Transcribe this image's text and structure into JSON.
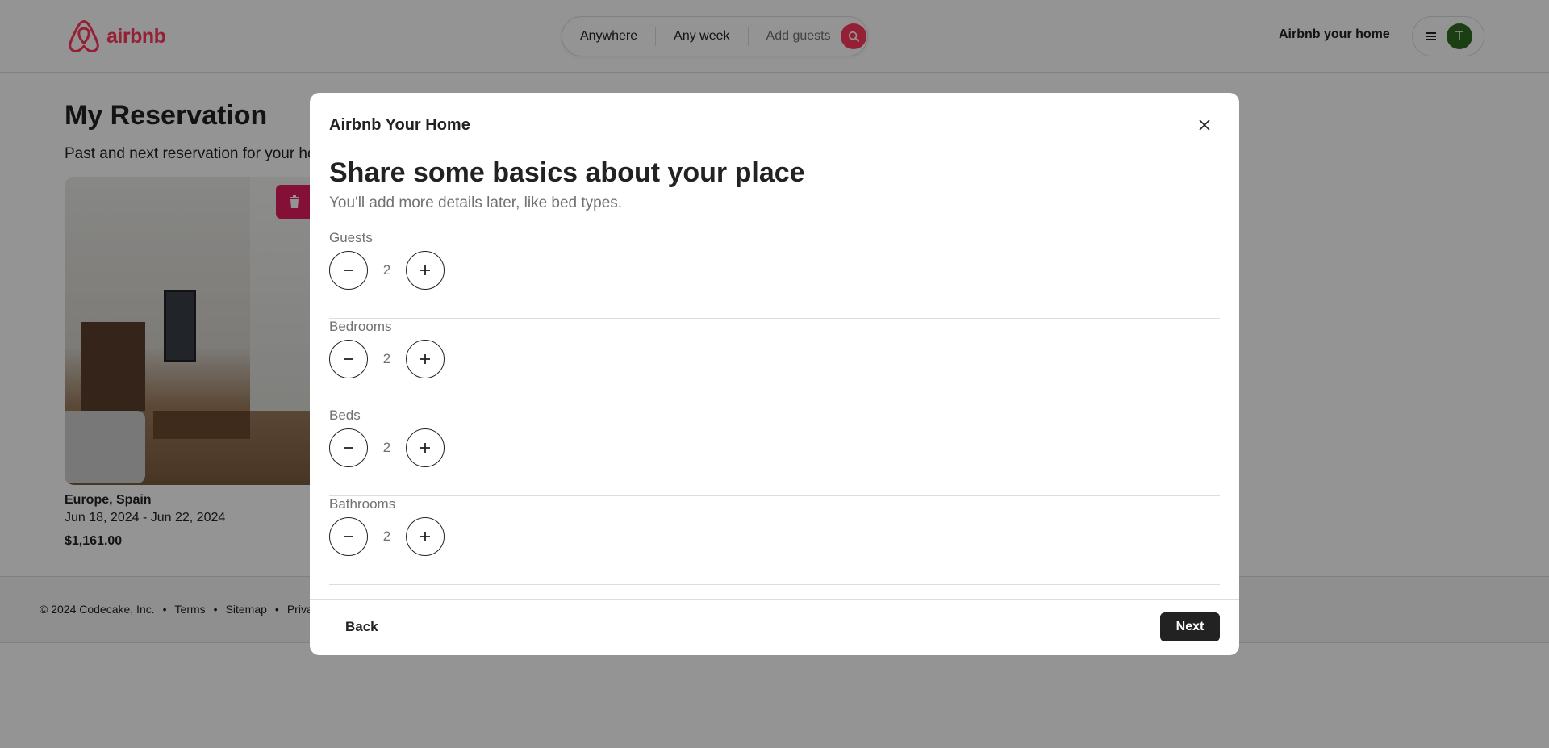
{
  "header": {
    "logo_text": "airbnb",
    "search": {
      "where": "Anywhere",
      "when": "Any week",
      "guests": "Add guests"
    },
    "host_link": "Airbnb your home",
    "avatar_initial": "T"
  },
  "page": {
    "title": "My Reservation",
    "subtitle": "Past and next reservation for your hou",
    "card": {
      "location": "Europe, Spain",
      "dates": "Jun 18, 2024 - Jun 22, 2024",
      "price": "$1,161.00"
    }
  },
  "footer": {
    "copyright": "© 2024 Codecake, Inc.",
    "links": [
      "Terms",
      "Sitemap",
      "Priva"
    ]
  },
  "modal": {
    "title": "Airbnb Your Home",
    "heading": "Share some basics about your place",
    "subheading": "You'll add more details later, like bed types.",
    "counters": [
      {
        "label": "Guests",
        "value": "2"
      },
      {
        "label": "Bedrooms",
        "value": "2"
      },
      {
        "label": "Beds",
        "value": "2"
      },
      {
        "label": "Bathrooms",
        "value": "2"
      }
    ],
    "back_label": "Back",
    "next_label": "Next"
  },
  "colors": {
    "brand": "#FF385C",
    "delete": "#E31C5F",
    "dark": "#222222"
  },
  "icons": [
    "airbnb-logo-icon",
    "search-icon",
    "menu-icon",
    "trash-icon",
    "close-icon",
    "minus-icon",
    "plus-icon"
  ]
}
